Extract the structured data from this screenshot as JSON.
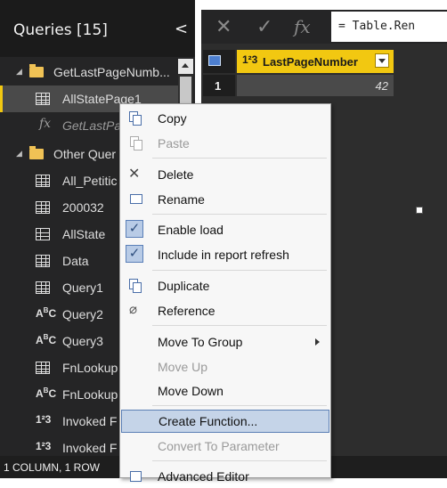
{
  "queries_pane": {
    "title": "Queries [15]",
    "collapse_glyph": "<",
    "groups": [
      {
        "name": "GetLastPageNumb..."
      },
      {
        "name": "Other Quer"
      }
    ],
    "items": [
      {
        "label": "AllStatePage1",
        "icon": "table-icon"
      },
      {
        "label": "GetLastPa",
        "icon": "function-icon"
      },
      {
        "label": "All_Petitic",
        "icon": "table-icon"
      },
      {
        "label": "200032",
        "icon": "table-icon"
      },
      {
        "label": "AllState",
        "icon": "list-icon"
      },
      {
        "label": "Data",
        "icon": "table-icon"
      },
      {
        "label": "Query1",
        "icon": "table-icon"
      },
      {
        "label": "Query2",
        "icon": "text-type-icon"
      },
      {
        "label": "Query3",
        "icon": "text-type-icon"
      },
      {
        "label": "FnLookup",
        "icon": "table-icon"
      },
      {
        "label": "FnLookup",
        "icon": "text-type-icon"
      },
      {
        "label": "Invoked F",
        "icon": "number-type-icon"
      },
      {
        "label": "Invoked F",
        "icon": "number-type-icon"
      }
    ]
  },
  "toolbar": {
    "cancel_glyph": "✕",
    "commit_glyph": "✓",
    "fx_glyph": "fx",
    "formula_text": "= Table.Ren"
  },
  "table": {
    "column_type": "1²3",
    "column_name": "LastPageNumber",
    "row_number": "1",
    "cell_value": "42"
  },
  "status_bar": {
    "text": "1 COLUMN, 1 ROW"
  },
  "context_menu": {
    "copy": "Copy",
    "paste": "Paste",
    "delete": "Delete",
    "rename": "Rename",
    "enable_load": "Enable load",
    "include_refresh": "Include in report refresh",
    "duplicate": "Duplicate",
    "reference": "Reference",
    "move_to_group": "Move To Group",
    "move_up": "Move Up",
    "move_down": "Move Down",
    "create_function": "Create Function...",
    "convert_parameter": "Convert To Parameter",
    "advanced_editor": "Advanced Editor"
  },
  "colors": {
    "accent_yellow": "#f2c811",
    "pane_background": "#252526",
    "menu_highlight": "#c5d4e8"
  }
}
